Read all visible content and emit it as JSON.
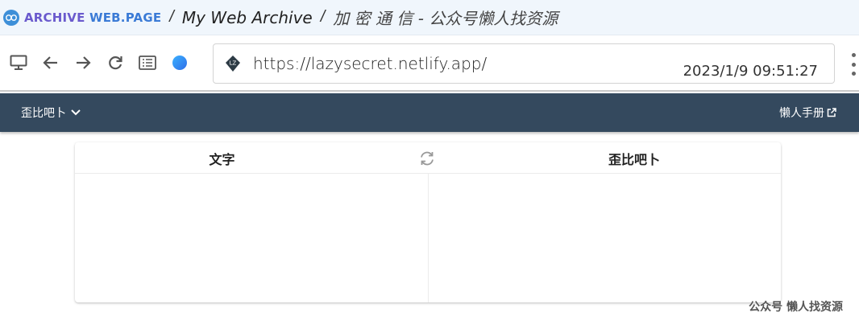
{
  "archive": {
    "brand_part1": "ARCHIVE ",
    "brand_part2": "WEB.PAGE",
    "separator": "/",
    "collection": "My Web Archive",
    "page_title": "加 密 通 信 - 公众号懒人找资源"
  },
  "browser": {
    "url": "https://lazysecret.netlify.app/",
    "timestamp": "2023/1/9 09:51:27",
    "icons": [
      "monitor-icon",
      "back-arrow-icon",
      "forward-arrow-icon",
      "reload-icon",
      "list-icon",
      "globe-dot-icon"
    ]
  },
  "navbar": {
    "dropdown_label": "歪比吧卜",
    "manual_link": "懒人手册"
  },
  "translator": {
    "source_lang": "文字",
    "target_lang": "歪比吧卜",
    "source_text": "",
    "target_text": ""
  },
  "watermark": "公众号 懒人找资源",
  "colors": {
    "navbar_bg": "#34495e",
    "archive_bar_bg": "#f0f6fc",
    "brand_purple": "#6a5acd",
    "brand_blue": "#3b7bd6"
  }
}
